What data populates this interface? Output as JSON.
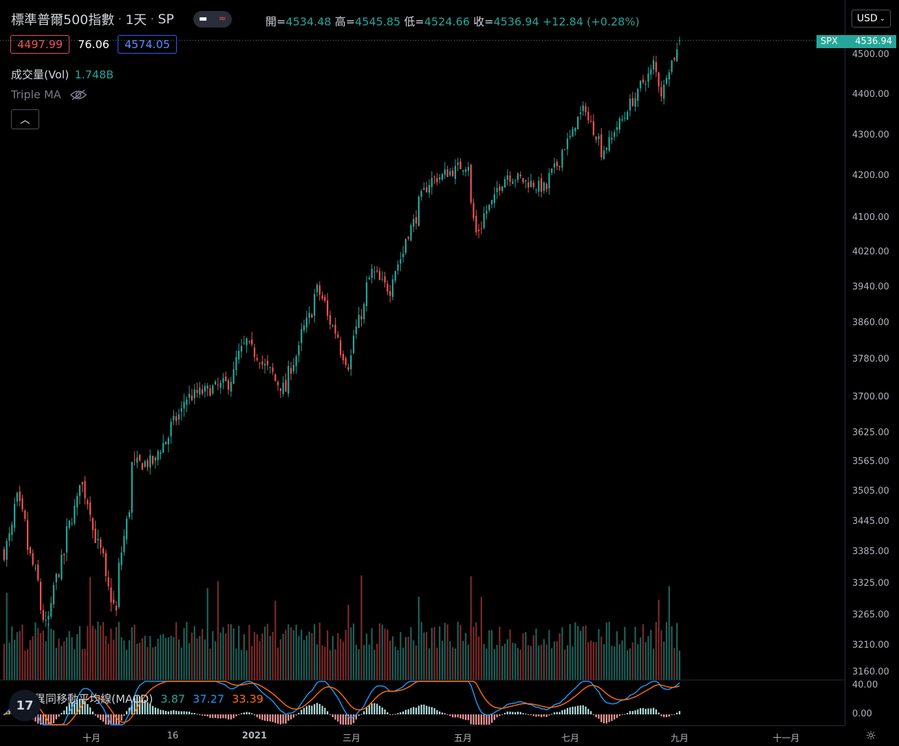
{
  "header": {
    "symbol_name": "標準普爾500指數",
    "interval": "1天",
    "exchange": "SP",
    "ohlc": {
      "open_label": "開=",
      "open": "4534.48",
      "high_label": "高=",
      "high": "4545.85",
      "low_label": "低=",
      "low": "4524.66",
      "close_label": "收=",
      "close": "4536.94",
      "change": "+12.84 (+0.28%)"
    }
  },
  "stats": {
    "sell": "4497.99",
    "spread": "76.06",
    "buy": "4574.05"
  },
  "volume_indicator": {
    "label": "成交量(Vol)",
    "value": "1.748B"
  },
  "ma_indicator": {
    "label": "Triple MA",
    "icon": "eye-off-icon"
  },
  "collapse_button": {
    "icon": "chevron-up-icon",
    "glyph": "︿"
  },
  "macd_indicator": {
    "label": "平滑異同移動平均線(MACD)",
    "hist": "3.87",
    "macd": "37.27",
    "signal": "33.39"
  },
  "currency_button": {
    "label": "USD",
    "icon": "chevron-down-icon"
  },
  "price_tag": {
    "symbol": "SPX",
    "value": "4536.94"
  },
  "logo": {
    "text": "17"
  },
  "colors": {
    "up": "#26a69a",
    "down": "#ef5350",
    "macd": "#2196f3",
    "signal": "#ff6d00"
  },
  "chart_data": {
    "type": "candlestick",
    "price_axis": {
      "ticks": [
        "4500.00",
        "4400.00",
        "4300.00",
        "4200.00",
        "4100.00",
        "4020.00",
        "3940.00",
        "3860.00",
        "3780.00",
        "3700.00",
        "3625.00",
        "3565.00",
        "3505.00",
        "3445.00",
        "3385.00",
        "3325.00",
        "3265.00",
        "3210.00",
        "3160.00"
      ]
    },
    "macd_axis": {
      "ticks": [
        "40.00",
        "0.00"
      ]
    },
    "time_axis": {
      "labels": [
        "十月",
        "16",
        "2021",
        "三月",
        "五月",
        "七月",
        "九月",
        "十一月"
      ]
    },
    "price_anchors": [
      {
        "date": "2020-09-01",
        "close": 3385
      },
      {
        "date": "2020-09-08",
        "close": 3490
      },
      {
        "date": "2020-09-23",
        "close": 3245
      },
      {
        "date": "2020-10-12",
        "close": 3530
      },
      {
        "date": "2020-10-30",
        "close": 3270
      },
      {
        "date": "2020-11-09",
        "close": 3560
      },
      {
        "date": "2020-11-20",
        "close": 3565
      },
      {
        "date": "2020-12-08",
        "close": 3700
      },
      {
        "date": "2020-12-30",
        "close": 3730
      },
      {
        "date": "2021-01-08",
        "close": 3820
      },
      {
        "date": "2021-01-29",
        "close": 3715
      },
      {
        "date": "2021-02-16",
        "close": 3935
      },
      {
        "date": "2021-03-04",
        "close": 3770
      },
      {
        "date": "2021-03-17",
        "close": 3975
      },
      {
        "date": "2021-03-26",
        "close": 3935
      },
      {
        "date": "2021-04-16",
        "close": 4185
      },
      {
        "date": "2021-05-07",
        "close": 4230
      },
      {
        "date": "2021-05-12",
        "close": 4065
      },
      {
        "date": "2021-05-28",
        "close": 4205
      },
      {
        "date": "2021-06-18",
        "close": 4170
      },
      {
        "date": "2021-07-09",
        "close": 4370
      },
      {
        "date": "2021-07-19",
        "close": 4260
      },
      {
        "date": "2021-08-16",
        "close": 4480
      },
      {
        "date": "2021-08-19",
        "close": 4405
      },
      {
        "date": "2021-08-27",
        "close": 4510
      },
      {
        "date": "2021-08-30",
        "close": 4537
      }
    ],
    "last": {
      "open": 4534.48,
      "high": 4545.85,
      "low": 4524.66,
      "close": 4536.94
    }
  }
}
